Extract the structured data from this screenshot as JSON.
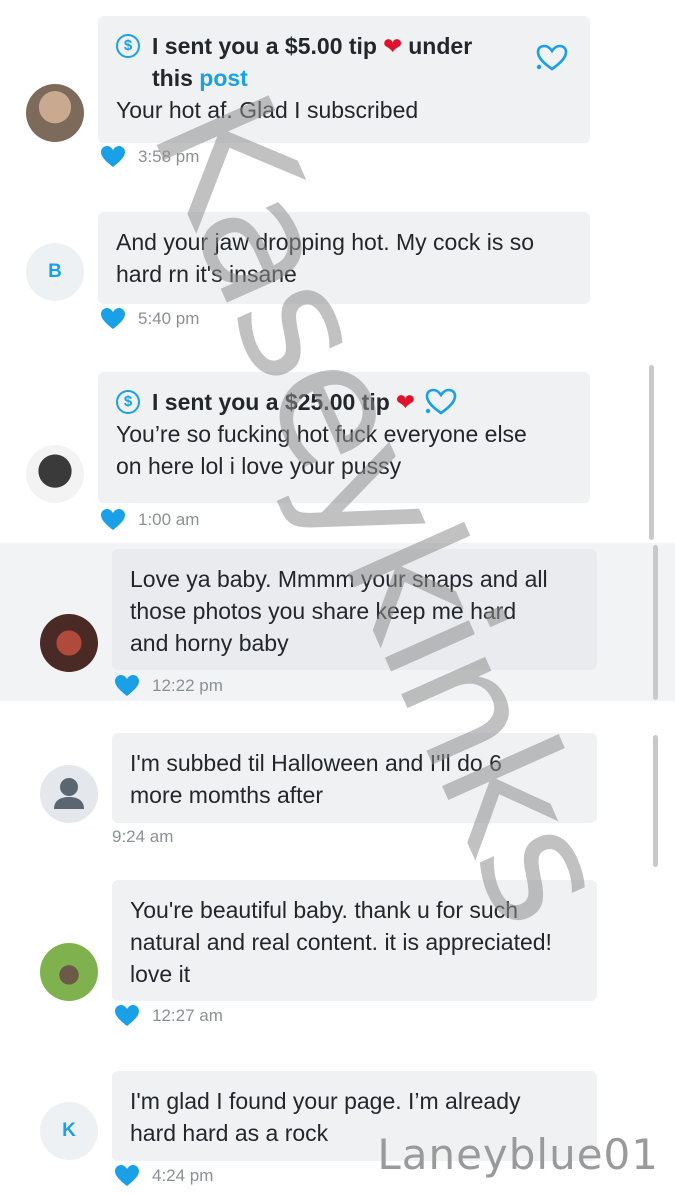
{
  "messages": [
    {
      "avatar": "photo",
      "tip_prefix": "I sent you a $5.00 tip",
      "tip_suffix": "under",
      "tip_line2_prefix": "this",
      "tip_link": "post",
      "text_lines": [
        "Your hot af. Glad I subscribed"
      ],
      "time": "3:58 pm",
      "liked": true
    },
    {
      "avatar_letter": "B",
      "text_lines": [
        "And your jaw dropping hot. My cock is so",
        "hard rn it's insane"
      ],
      "time": "5:40 pm",
      "liked": true
    },
    {
      "avatar": "photo",
      "tip_prefix": "I sent you a $25.00 tip",
      "text_lines": [
        "You’re so fucking hot fuck everyone else",
        "on here lol i love your pussy"
      ],
      "time": "1:00 am",
      "liked": true
    },
    {
      "avatar": "photo",
      "text_lines": [
        "Love ya baby. Mmmm your snaps and all",
        "those photos you share keep me hard",
        "and horny baby"
      ],
      "time": "12:22 pm",
      "liked": true
    },
    {
      "avatar": "default",
      "text_lines": [
        "I'm subbed til Halloween and I'll do 6",
        "more momths after"
      ],
      "time": "9:24 am",
      "liked": false
    },
    {
      "avatar": "photo",
      "text_lines": [
        "You're beautiful baby. thank u for such",
        "natural and real content. it is appreciated!",
        "love it"
      ],
      "time": "12:27 am",
      "liked": true
    },
    {
      "avatar_letter": "K",
      "text_lines": [
        "I'm glad I found your page. I’m already",
        "hard hard as a rock"
      ],
      "time": "4:24 pm",
      "liked": true
    }
  ],
  "watermark": "Kaseykinks",
  "signature": "Laneyblue01",
  "colors": {
    "accent": "#1aa0e6",
    "bubble": "#eff1f3",
    "heart": "#e0132d",
    "watermark": "#8e8e8e"
  }
}
